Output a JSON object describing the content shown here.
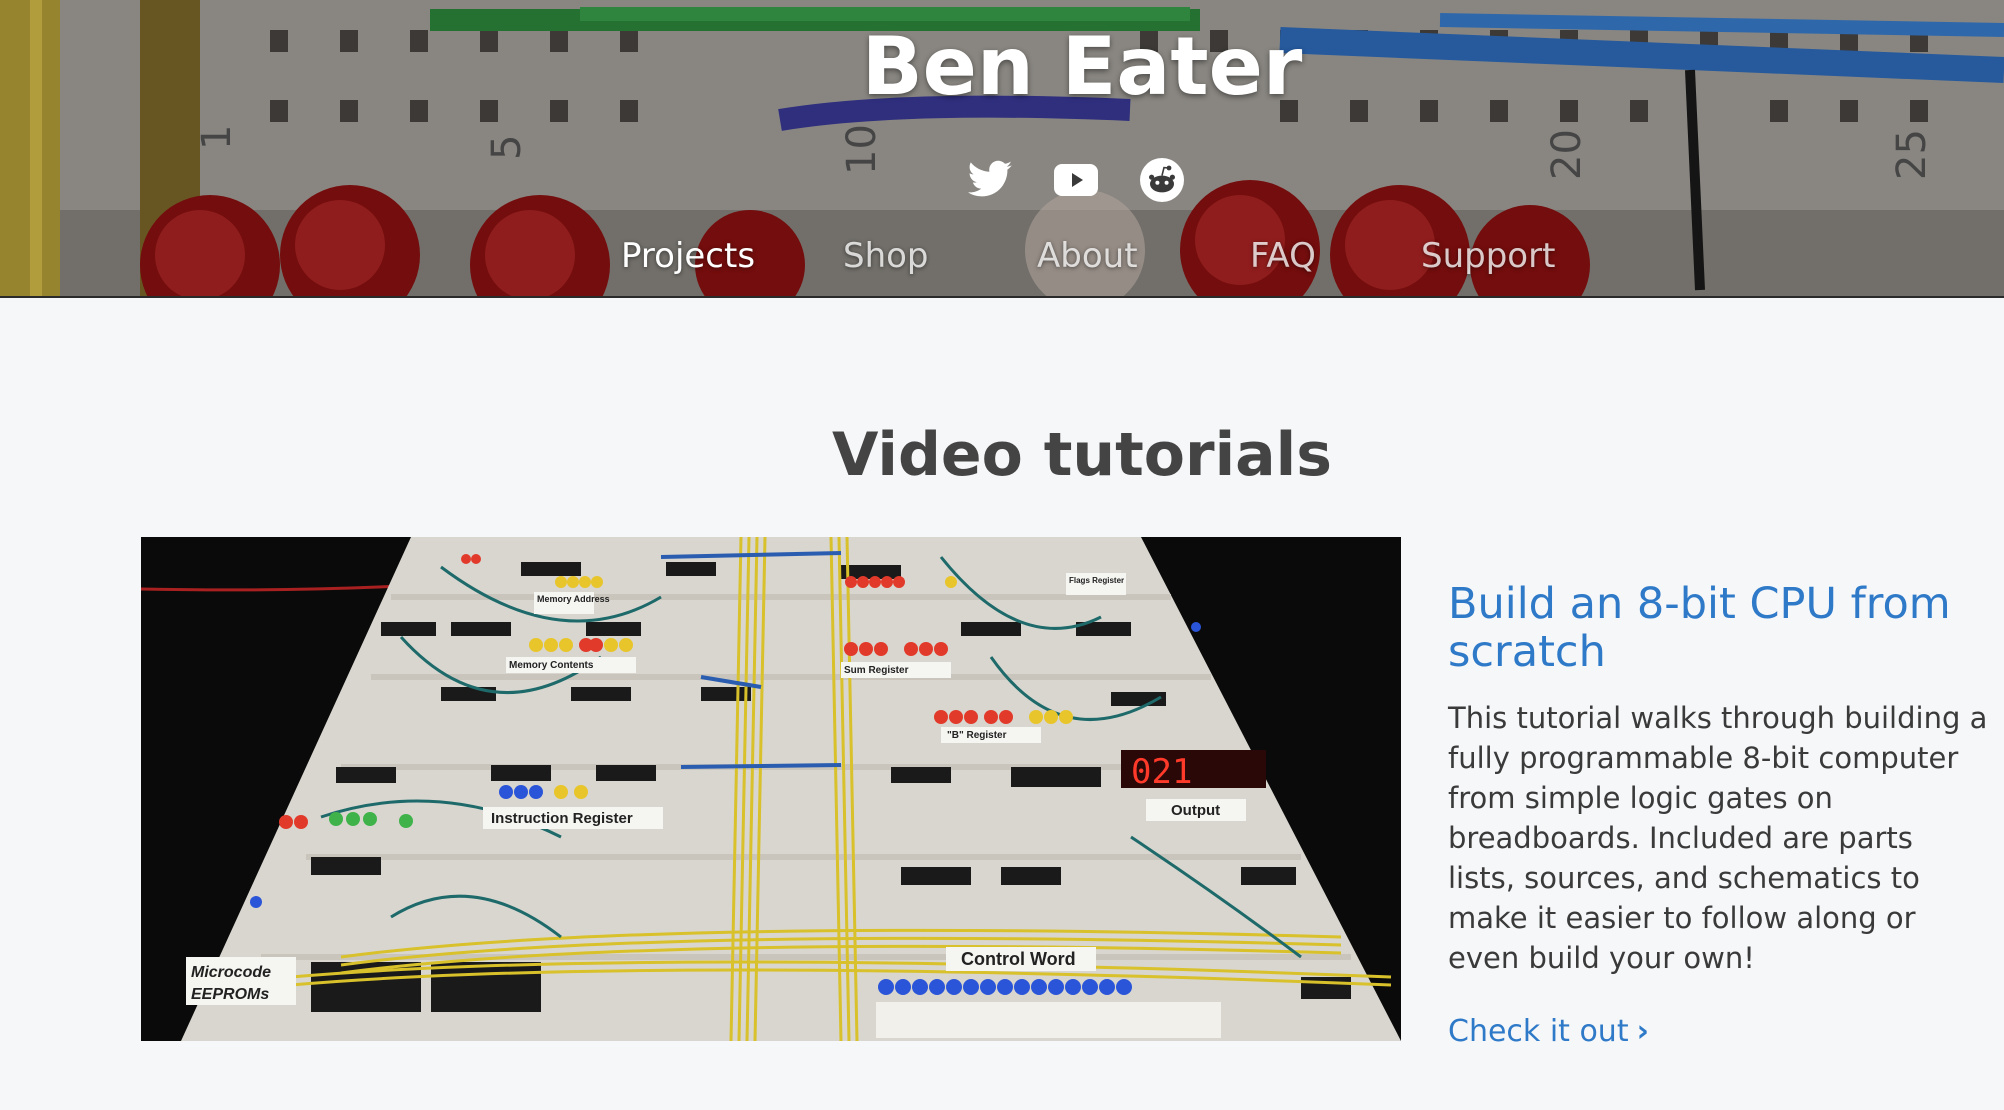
{
  "site": {
    "title": "Ben Eater"
  },
  "social": [
    {
      "name": "twitter",
      "icon": "twitter-icon"
    },
    {
      "name": "youtube",
      "icon": "youtube-icon"
    },
    {
      "name": "reddit",
      "icon": "reddit-icon"
    }
  ],
  "nav": {
    "items": [
      {
        "label": "Projects",
        "active": true
      },
      {
        "label": "Shop",
        "active": false
      },
      {
        "label": "About",
        "active": false
      },
      {
        "label": "FAQ",
        "active": false
      },
      {
        "label": "Support",
        "active": false
      }
    ]
  },
  "main": {
    "section_title": "Video tutorials",
    "card": {
      "title": "Build an 8-bit CPU from scratch",
      "description": "This tutorial walks through building a fully programmable 8-bit computer from simple logic gates on breadboards. Included are parts lists, sources, and schematics to make it easier to follow along or even build your own!",
      "link_label": "Check it out",
      "link_icon": "chevron-right-icon",
      "image_labels": {
        "memory_address": "Memory Address",
        "memory_contents": "Memory Contents",
        "sum_register": "Sum Register",
        "flags_register": "Flags Register",
        "b_register": "\"B\" Register",
        "instruction_register": "Instruction Register",
        "output": "Output",
        "output_display": "021",
        "control_word": "Control Word",
        "microcode": "Microcode",
        "eeproms": "EEPROMs"
      }
    }
  },
  "colors": {
    "accent": "#2f7ac8",
    "heading": "#444444",
    "body_text": "#3a3a3a",
    "page_bg": "#f6f7f9"
  }
}
